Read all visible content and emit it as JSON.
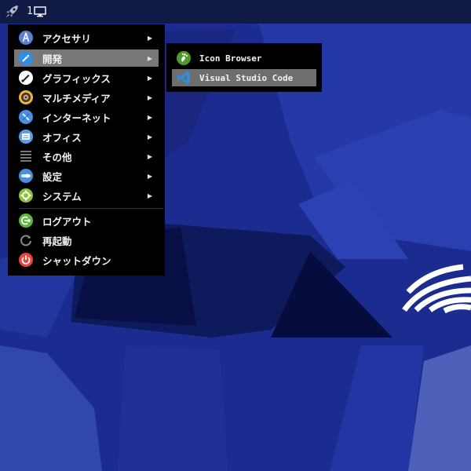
{
  "taskbar": {
    "launcher_icon": "rocket-icon",
    "workspace_number": "1",
    "workspace_icon": "monitor-icon"
  },
  "menu": {
    "items": [
      {
        "label": "アクセサリ",
        "icon": "accessories-icon",
        "color": "#5d7fd6"
      },
      {
        "label": "開発",
        "icon": "development-icon",
        "color": "#2f8de4"
      },
      {
        "label": "グラフィックス",
        "icon": "graphics-icon",
        "color": "#ffffff"
      },
      {
        "label": "マルチメディア",
        "icon": "multimedia-icon",
        "color": "#f3b13b"
      },
      {
        "label": "インターネット",
        "icon": "internet-icon",
        "color": "#4a8fdf"
      },
      {
        "label": "オフィス",
        "icon": "office-icon",
        "color": "#5aa0e6"
      },
      {
        "label": "その他",
        "icon": "other-icon",
        "color": "#888888"
      },
      {
        "label": "設定",
        "icon": "settings-icon",
        "color": "#4a8fdf"
      },
      {
        "label": "システム",
        "icon": "system-icon",
        "color": "#8ac33a"
      }
    ],
    "actions": [
      {
        "label": "ログアウト",
        "icon": "logout-icon",
        "color": "#5cb83c"
      },
      {
        "label": "再起動",
        "icon": "restart-icon",
        "color": "#888888"
      },
      {
        "label": "シャットダウン",
        "icon": "shutdown-icon",
        "color": "#e8453c"
      }
    ]
  },
  "submenu": {
    "items": [
      {
        "label": "Icon Browser",
        "icon": "gnome-foot-icon",
        "color": "#4e9a2a"
      },
      {
        "label": "Visual Studio Code",
        "icon": "vscode-icon",
        "color": "#2f8de4"
      }
    ]
  },
  "colors": {
    "desktop_bg": "#1b2a8f",
    "taskbar_bg": "#111a44",
    "menu_bg": "#000000",
    "highlight": "#777777"
  }
}
